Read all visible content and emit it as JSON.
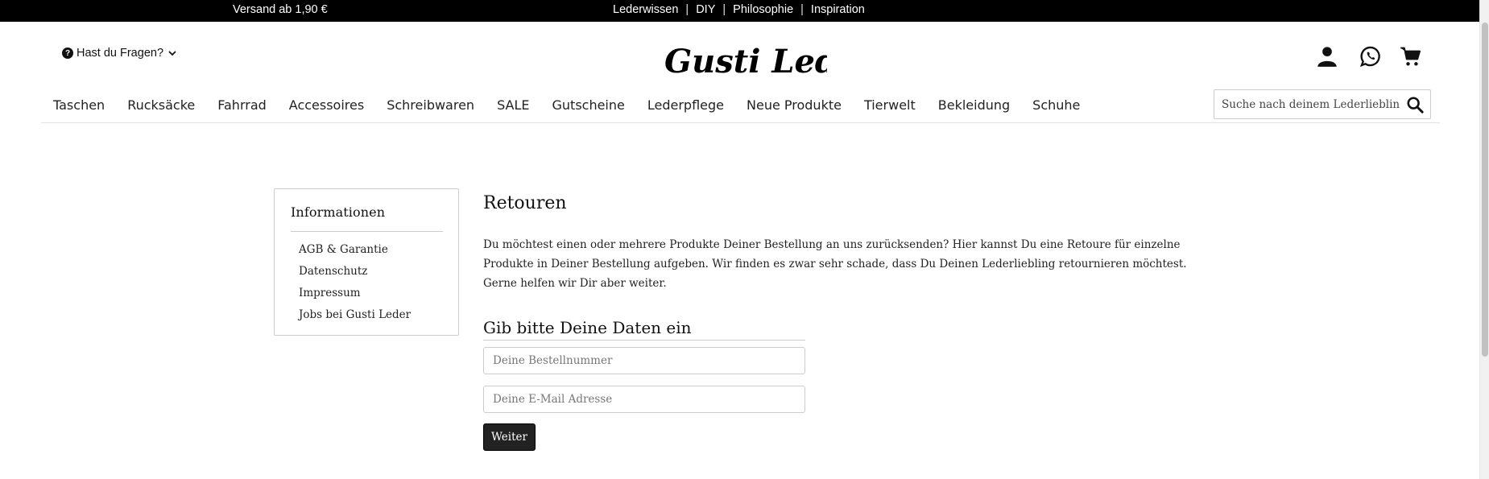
{
  "topbar": {
    "shipping": "Versand ab 1,90 €",
    "links": [
      "Lederwissen",
      "DIY",
      "Philosophie",
      "Inspiration"
    ],
    "separator": "|"
  },
  "header": {
    "help_label": "Hast du Fragen?",
    "logo_text": "Gusti Leder",
    "icons": [
      "user-icon",
      "whatsapp-icon",
      "cart-icon"
    ]
  },
  "nav": {
    "items": [
      "Taschen",
      "Rucksäcke",
      "Fahrrad",
      "Accessoires",
      "Schreibwaren",
      "SALE",
      "Gutscheine",
      "Lederpflege",
      "Neue Produkte",
      "Tierwelt",
      "Bekleidung",
      "Schuhe"
    ]
  },
  "search": {
    "placeholder": "Suche nach deinem Lederliebling"
  },
  "sidebar": {
    "title": "Informationen",
    "items": [
      "AGB & Garantie",
      "Datenschutz",
      "Impressum",
      "Jobs bei Gusti Leder"
    ]
  },
  "main": {
    "title": "Retouren",
    "description": "Du möchtest einen oder mehrere Produkte Deiner Bestellung an uns zurücksenden? Hier kannst Du eine Retoure für einzelne Produkte in Deiner Bestellung aufgeben. Wir finden es zwar sehr schade, dass Du Deinen Lederliebling retournieren möchtest. Gerne helfen wir Dir aber weiter.",
    "form_title": "Gib bitte Deine Daten ein",
    "order_placeholder": "Deine Bestellnummer",
    "email_placeholder": "Deine E-Mail Adresse",
    "submit_label": "Weiter"
  }
}
